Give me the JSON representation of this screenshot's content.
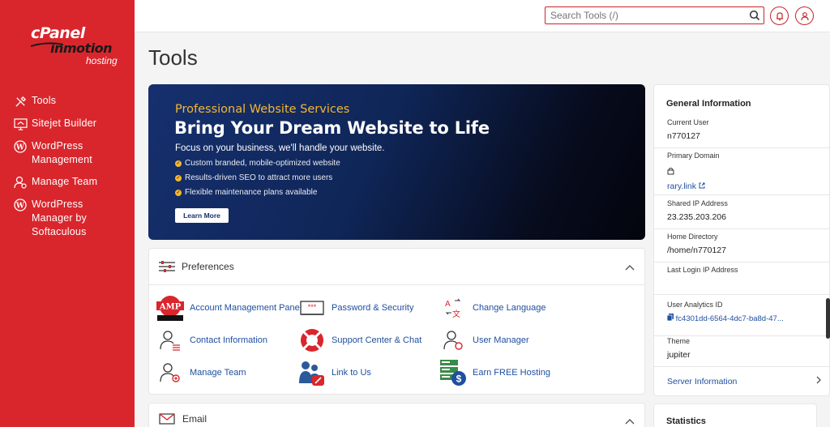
{
  "brand": {
    "cpanel": "cPanel",
    "inmotion": "inmotion",
    "hosting": "hosting"
  },
  "sidebar": {
    "items": [
      {
        "label": "Tools",
        "icon": "tools-icon"
      },
      {
        "label": "Sitejet Builder",
        "icon": "sitejet-icon"
      },
      {
        "label": "WordPress Management",
        "icon": "wordpress-icon"
      },
      {
        "label": "Manage Team",
        "icon": "manage-team-icon"
      },
      {
        "label": "WordPress Manager by Softaculous",
        "icon": "wordpress-icon"
      }
    ]
  },
  "search": {
    "placeholder": "Search Tools (/)"
  },
  "page": {
    "title": "Tools"
  },
  "banner": {
    "subtitle": "Professional Website Services",
    "heading": "Bring Your Dream Website to Life",
    "description": "Focus on your business, we'll handle your website.",
    "bullets": [
      "Custom branded, mobile-optimized website",
      "Results-driven SEO to attract more users",
      "Flexible maintenance plans available"
    ],
    "button": "Learn More"
  },
  "preferences": {
    "title": "Preferences",
    "tools": [
      {
        "label": "Account Management Panel",
        "icon": "amp-icon"
      },
      {
        "label": "Password & Security",
        "icon": "password-icon"
      },
      {
        "label": "Change Language",
        "icon": "language-icon"
      },
      {
        "label": "Contact Information",
        "icon": "contact-icon"
      },
      {
        "label": "Support Center & Chat",
        "icon": "support-icon"
      },
      {
        "label": "User Manager",
        "icon": "user-manager-icon"
      },
      {
        "label": "Manage Team",
        "icon": "manage-team-icon"
      },
      {
        "label": "Link to Us",
        "icon": "link-to-us-icon"
      },
      {
        "label": "Earn FREE Hosting",
        "icon": "earn-hosting-icon"
      }
    ],
    "amp_badge": "AMP"
  },
  "email": {
    "title": "Email"
  },
  "general": {
    "title": "General Information",
    "current_user_label": "Current User",
    "current_user": "n770127",
    "primary_domain_label": "Primary Domain",
    "primary_domain": "rary.link",
    "shared_ip_label": "Shared IP Address",
    "shared_ip": "23.235.203.206",
    "home_dir_label": "Home Directory",
    "home_dir": "/home/n770127",
    "last_login_label": "Last Login IP Address",
    "last_login": "",
    "analytics_label": "User Analytics ID",
    "analytics": "fc4301dd-6564-4dc7-ba8d-47...",
    "theme_label": "Theme",
    "theme": "jupiter",
    "server_info": "Server Information"
  },
  "statistics": {
    "title": "Statistics"
  },
  "colors": {
    "brand_red": "#d9262c",
    "link_blue": "#1f4fa0",
    "banner_gold": "#f5b731"
  }
}
